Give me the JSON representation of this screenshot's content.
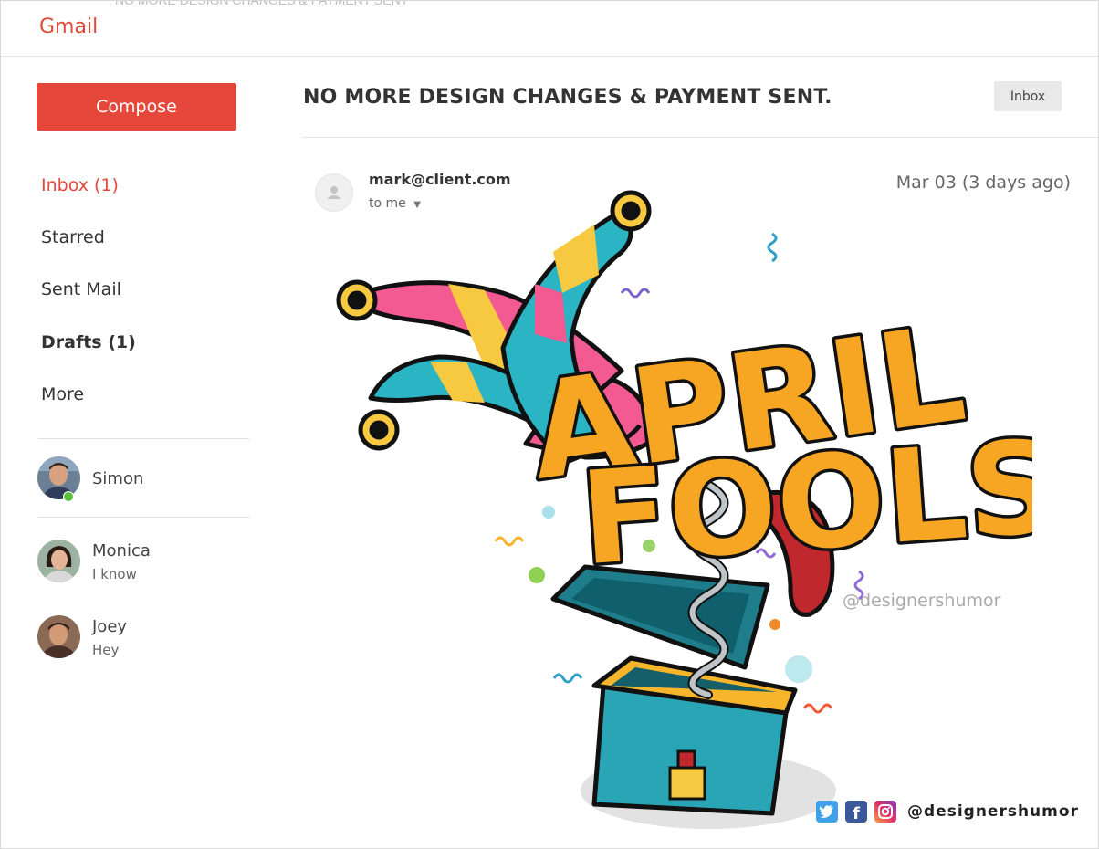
{
  "app": {
    "title": "Gmail"
  },
  "header": {
    "ghost_text": "NO MORE DESIGN CHANGES & PAYMENT SENT"
  },
  "sidebar": {
    "compose_label": "Compose",
    "items": [
      {
        "label": "Inbox (1)"
      },
      {
        "label": "Starred"
      },
      {
        "label": "Sent Mail"
      },
      {
        "label": "Drafts (1)"
      },
      {
        "label": "More"
      }
    ],
    "contacts": [
      {
        "name": "Simon",
        "status": ""
      },
      {
        "name": "Monica",
        "status": "I know"
      },
      {
        "name": "Joey",
        "status": "Hey"
      }
    ]
  },
  "email": {
    "subject": "NO MORE DESIGN CHANGES & PAYMENT SENT.",
    "label": "Inbox",
    "sender": "mark@client.com",
    "to": "to me",
    "date": "Mar 03 (3 days ago)",
    "image": {
      "headline_line1": "APRIL",
      "headline_line2": "FOOLS",
      "watermark": "@designershumor",
      "social_handle": "@designershumor",
      "social_icons": [
        "twitter-icon",
        "facebook-icon",
        "instagram-icon"
      ]
    }
  },
  "colors": {
    "brand_red": "#e5473a",
    "gmail_logo": "#dd4b39",
    "online_green": "#57c23a"
  }
}
